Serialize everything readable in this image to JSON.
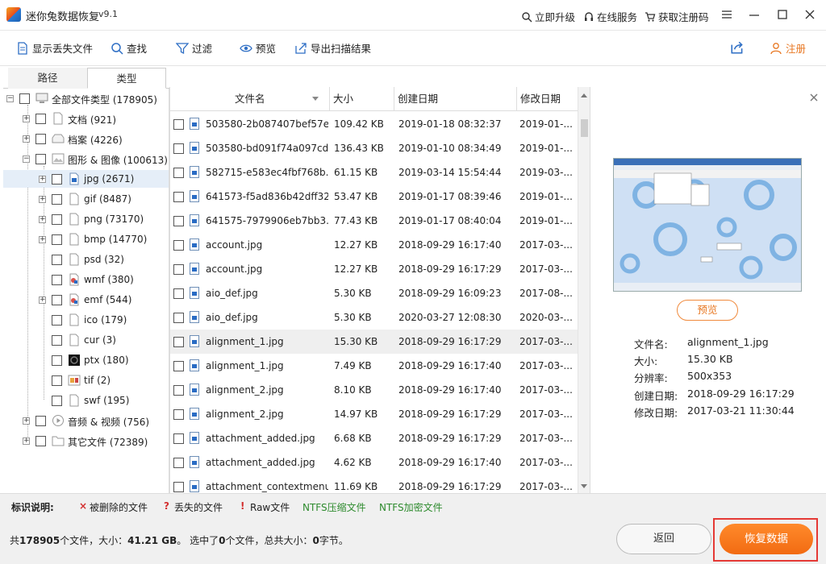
{
  "app": {
    "title": "迷你兔数据恢复",
    "version": "v9.1",
    "top_links": [
      "立即升级",
      "在线服务",
      "获取注册码"
    ]
  },
  "toolbar": {
    "show_lost": "显示丢失文件",
    "find": "查找",
    "filter": "过滤",
    "preview": "预览",
    "export": "导出扫描结果",
    "register": "注册"
  },
  "tabs": {
    "path": "路径",
    "type": "类型"
  },
  "tree": [
    {
      "label": "全部文件类型 (178905)",
      "icon": "computer-icon"
    },
    {
      "label": "文档 (921)",
      "icon": "document-icon"
    },
    {
      "label": "档案 (4226)",
      "icon": "archive-icon"
    },
    {
      "label": "图形 & 图像 (100613)",
      "icon": "image-icon"
    },
    {
      "label": "jpg (2671)",
      "icon": "jpg-icon"
    },
    {
      "label": "gif (8487)",
      "icon": "file-icon"
    },
    {
      "label": "png (73170)",
      "icon": "file-icon"
    },
    {
      "label": "bmp (14770)",
      "icon": "file-icon"
    },
    {
      "label": "psd (32)",
      "icon": "file-icon"
    },
    {
      "label": "wmf (380)",
      "icon": "wmf-icon"
    },
    {
      "label": "emf (544)",
      "icon": "emf-icon"
    },
    {
      "label": "ico (179)",
      "icon": "file-icon"
    },
    {
      "label": "cur (3)",
      "icon": "file-icon"
    },
    {
      "label": "ptx (180)",
      "icon": "ptx-icon"
    },
    {
      "label": "tif (2)",
      "icon": "tif-icon"
    },
    {
      "label": "swf (195)",
      "icon": "file-icon"
    },
    {
      "label": "音频 & 视频 (756)",
      "icon": "media-icon"
    },
    {
      "label": "其它文件 (72389)",
      "icon": "folder-icon"
    }
  ],
  "table": {
    "headers": [
      "文件名",
      "大小",
      "创建日期",
      "修改日期"
    ],
    "rows": [
      [
        "503580-2b087407bef57e...",
        "109.42 KB",
        "2019-01-18 08:32:37",
        "2019-01-..."
      ],
      [
        "503580-bd091f74a097cd...",
        "136.43 KB",
        "2019-01-10 08:34:49",
        "2019-01-..."
      ],
      [
        "582715-e583ec4fbf768b...",
        "61.15 KB",
        "2019-03-14 15:54:44",
        "2019-03-..."
      ],
      [
        "641573-f5ad836b42dff32...",
        "53.47 KB",
        "2019-01-17 08:39:46",
        "2019-01-..."
      ],
      [
        "641575-7979906eb7bb3...",
        "77.43 KB",
        "2019-01-17 08:40:04",
        "2019-01-..."
      ],
      [
        "account.jpg",
        "12.27 KB",
        "2018-09-29 16:17:40",
        "2017-03-..."
      ],
      [
        "account.jpg",
        "12.27 KB",
        "2018-09-29 16:17:29",
        "2017-03-..."
      ],
      [
        "aio_def.jpg",
        "5.30 KB",
        "2018-09-29 16:09:23",
        "2017-08-..."
      ],
      [
        "aio_def.jpg",
        "5.30 KB",
        "2020-03-27 12:08:30",
        "2020-03-..."
      ],
      [
        "alignment_1.jpg",
        "15.30 KB",
        "2018-09-29 16:17:29",
        "2017-03-..."
      ],
      [
        "alignment_1.jpg",
        "7.49 KB",
        "2018-09-29 16:17:40",
        "2017-03-..."
      ],
      [
        "alignment_2.jpg",
        "8.10 KB",
        "2018-09-29 16:17:40",
        "2017-03-..."
      ],
      [
        "alignment_2.jpg",
        "14.97 KB",
        "2018-09-29 16:17:29",
        "2017-03-..."
      ],
      [
        "attachment_added.jpg",
        "6.68 KB",
        "2018-09-29 16:17:29",
        "2017-03-..."
      ],
      [
        "attachment_added.jpg",
        "4.62 KB",
        "2018-09-29 16:17:40",
        "2017-03-..."
      ],
      [
        "attachment_contextmenu...",
        "11.69 KB",
        "2018-09-29 16:17:29",
        "2017-03-..."
      ]
    ]
  },
  "preview_pane": {
    "button": "预览",
    "info": [
      [
        "文件名:",
        "alignment_1.jpg"
      ],
      [
        "大小:",
        "15.30 KB"
      ],
      [
        "分辨率:",
        "500x353"
      ],
      [
        "创建日期:",
        "2018-09-29 16:17:29"
      ],
      [
        "修改日期:",
        "2017-03-21 11:30:44"
      ]
    ]
  },
  "legend": {
    "title": "标识说明:",
    "deleted": "被删除的文件",
    "lost": "丢失的文件",
    "raw": "Raw文件",
    "ntfs_compressed": "NTFS压缩文件",
    "ntfs_encrypted": "NTFS加密文件",
    "colors": {
      "deleted": "#d32f2f",
      "ntfs": "#2e8b2e"
    }
  },
  "footer": {
    "total_count": "178905",
    "total_size": "41.21 GB",
    "selected_count": "0",
    "selected_size": "0",
    "back": "返回",
    "recover": "恢复数据"
  }
}
